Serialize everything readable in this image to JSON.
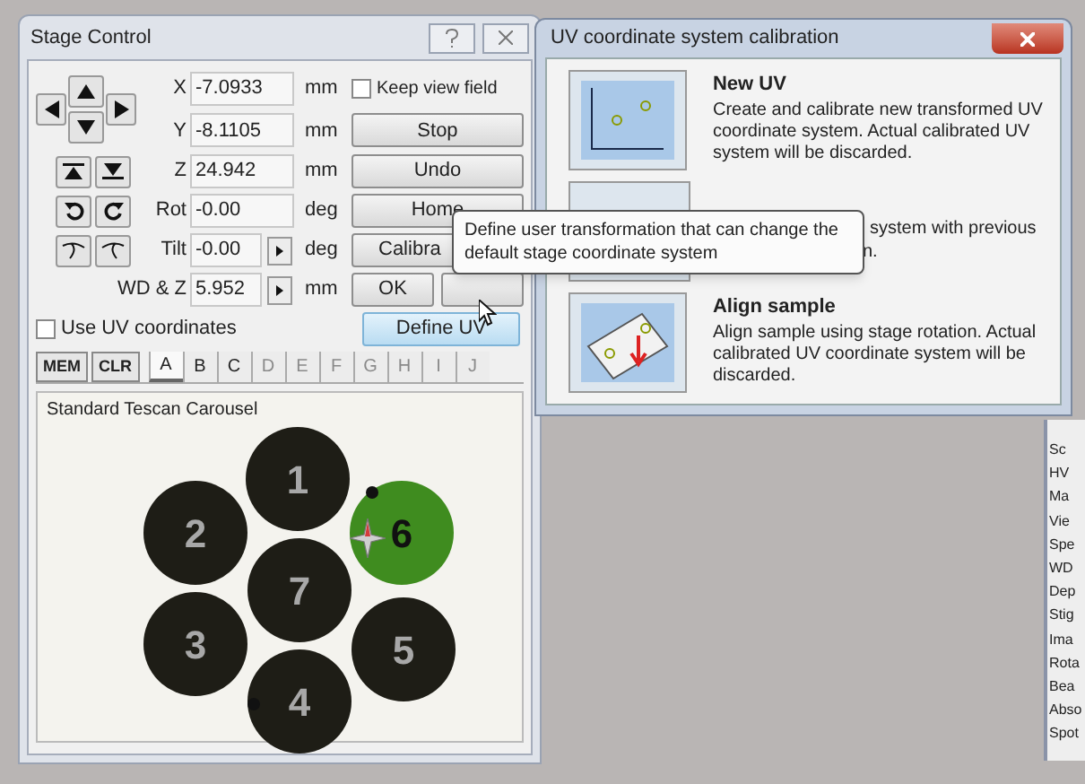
{
  "stage_control": {
    "title": "Stage Control",
    "axes": [
      {
        "label": "X",
        "value": "-7.0933",
        "unit": "mm",
        "kind": "plain"
      },
      {
        "label": "Y",
        "value": "-8.1105",
        "unit": "mm",
        "kind": "plain"
      },
      {
        "label": "Z",
        "value": "24.942",
        "unit": "mm",
        "kind": "plain"
      },
      {
        "label": "Rot",
        "value": "-0.00",
        "unit": "deg",
        "kind": "plain"
      },
      {
        "label": "Tilt",
        "value": "-0.00",
        "unit": "deg",
        "kind": "stepper"
      },
      {
        "label": "WD & Z",
        "value": "5.952",
        "unit": "mm",
        "kind": "stepper"
      }
    ],
    "keep_view_field": {
      "label": "Keep view field",
      "checked": false
    },
    "buttons": [
      "Stop",
      "Undo",
      "Home",
      "Calibra"
    ],
    "ok_button": "OK",
    "define_uv_button": "Define UV",
    "use_uv": {
      "label": "Use UV coordinates",
      "checked": false
    },
    "memory_buttons": [
      "MEM",
      "CLR"
    ],
    "tabs": [
      {
        "label": "A",
        "selected": true,
        "disabled": false
      },
      {
        "label": "B",
        "selected": false,
        "disabled": false
      },
      {
        "label": "C",
        "selected": false,
        "disabled": false
      },
      {
        "label": "D",
        "selected": false,
        "disabled": true
      },
      {
        "label": "E",
        "selected": false,
        "disabled": true
      },
      {
        "label": "F",
        "selected": false,
        "disabled": true
      },
      {
        "label": "G",
        "selected": false,
        "disabled": true
      },
      {
        "label": "H",
        "selected": false,
        "disabled": true
      },
      {
        "label": "I",
        "selected": false,
        "disabled": true
      },
      {
        "label": "J",
        "selected": false,
        "disabled": true
      }
    ],
    "carousel": {
      "title": "Standard Tescan Carousel",
      "positions": [
        {
          "label": "1",
          "selected": false
        },
        {
          "label": "2",
          "selected": false
        },
        {
          "label": "3",
          "selected": false
        },
        {
          "label": "4",
          "selected": false
        },
        {
          "label": "5",
          "selected": false
        },
        {
          "label": "6",
          "selected": true
        },
        {
          "label": "7",
          "selected": false
        }
      ]
    }
  },
  "uv_dialog": {
    "title": "UV coordinate system calibration",
    "options": [
      {
        "title": "New UV",
        "description": "Create and calibrate new transformed UV coordinate system. Actual calibrated UV system will be discarded."
      },
      {
        "fragments": [
          "system with previous",
          "n."
        ]
      },
      {
        "title": "Align sample",
        "description": "Align sample using stage rotation. Actual calibrated UV coordinate system will be discarded."
      }
    ]
  },
  "tooltip": {
    "text": "Define user transformation that can change the default stage coordinate system"
  },
  "side_panel": {
    "labels": [
      "Sc",
      "HV",
      "Ma",
      "Vie",
      "Spe",
      "WD",
      "Dep",
      "Stig",
      "Ima",
      "Rota",
      "Bea",
      "Abso",
      "Spot"
    ]
  }
}
